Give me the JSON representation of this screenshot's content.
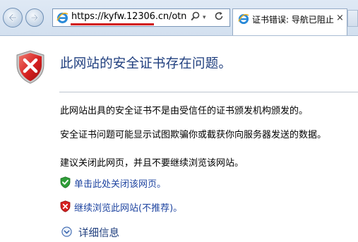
{
  "browser": {
    "address_bar": {
      "url": "https://kyfw.12306.cn/otn",
      "search_icon": "search-icon",
      "dropdown_icon": "chevron-down-icon",
      "refresh_icon": "refresh-icon"
    },
    "tab": {
      "title": "证书错误: 导航已阻止",
      "close_label": "×"
    },
    "nav": {
      "back_icon": "back-arrow-icon",
      "forward_icon": "forward-arrow-icon"
    }
  },
  "page": {
    "title": "此网站的安全证书存在问题。",
    "paragraphs": [
      "此网站出具的安全证书不是由受信任的证书颁发机构颁发的。",
      "安全证书问题可能显示试图欺骗你或截获你向服务器发送的数据。",
      "建议关闭此网页，并且不要继续浏览该网站。"
    ],
    "options": {
      "close_page": "单击此处关闭该网页。",
      "continue": "继续浏览此网站(不推荐)。"
    },
    "details": "详细信息"
  },
  "colors": {
    "title": "#1f3e7e",
    "link": "#1e44a0",
    "error_red": "#d62020",
    "url_underline": "#d11515"
  }
}
